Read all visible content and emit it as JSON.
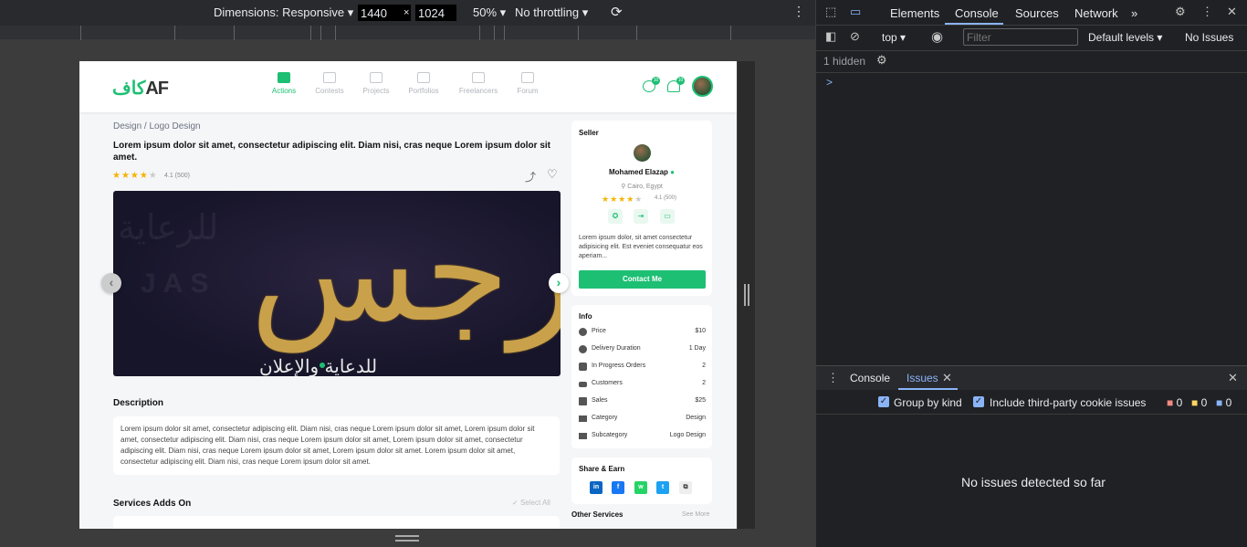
{
  "device_toolbar": {
    "dimensions_label": "Dimensions: Responsive",
    "width": "1440",
    "height": "1024",
    "times": "×",
    "zoom": "50%",
    "throttling": "No throttling"
  },
  "site": {
    "logo_prefix": "كاف",
    "logo_text": "AF",
    "nav": [
      {
        "label": "Actions",
        "active": true
      },
      {
        "label": "Contests"
      },
      {
        "label": "Projects"
      },
      {
        "label": "Portfolios"
      },
      {
        "label": "Freelancers"
      },
      {
        "label": "Forum"
      }
    ],
    "messages_badge": "10",
    "notifications_badge": "10",
    "breadcrumb": "Design / Logo Design",
    "title": "Lorem ipsum dolor sit amet, consectetur adipiscing elit. Diam nisi, cras neque Lorem ipsum dolor sit amet.",
    "rating": "4.1 (500)",
    "hero_text": "البرجس",
    "hero_sub": "للدعاية والإعلان",
    "description_heading": "Description",
    "description": "Lorem ipsum dolor sit amet, consectetur adipiscing elit. Diam nisi, cras neque Lorem ipsum dolor sit amet, Lorem ipsum dolor sit amet, consectetur adipiscing elit. Diam nisi, cras neque Lorem ipsum dolor sit amet, Lorem ipsum dolor sit amet, consectetur adipiscing elit. Diam nisi, cras neque Lorem ipsum dolor sit amet, Lorem ipsum dolor sit amet. Lorem ipsum dolor sit amet, consectetur adipiscing elit. Diam nisi, cras neque Lorem ipsum dolor sit amet.",
    "addons_heading": "Services Adds On",
    "select_all": "Select All",
    "seller": {
      "label": "Seller",
      "name": "Mohamed Elazap",
      "location": "Cairo, Egypt",
      "rating": "4.1 (500)",
      "bio": "Lorem ipsum dolor, sit amet consectetur adipisicing elit. Est eveniet consequatur eos aperiam...",
      "contact_label": "Contact Me"
    },
    "info": {
      "label": "Info",
      "rows": [
        {
          "key": "Price",
          "value": "$10"
        },
        {
          "key": "Delivery Duration",
          "value": "1 Day"
        },
        {
          "key": "In Progress Orders",
          "value": "2"
        },
        {
          "key": "Customers",
          "value": "2"
        },
        {
          "key": "Sales",
          "value": "$25"
        },
        {
          "key": "Category",
          "value": "Design"
        },
        {
          "key": "Subcategory",
          "value": "Logo Design"
        }
      ]
    },
    "share_label": "Share & Earn",
    "share_icons": [
      "in",
      "f",
      "w",
      "t",
      "⧉"
    ],
    "other_services": "Other Services",
    "see_more": "See More",
    "brand_color": "#1dbf73"
  },
  "devtools": {
    "tabs": [
      "Elements",
      "Console",
      "Sources",
      "Network"
    ],
    "active_tab": "Console",
    "context": "top",
    "filter_placeholder": "Filter",
    "levels": "Default levels",
    "issues_status": "No Issues",
    "hidden": "1 hidden",
    "prompt": ">",
    "drawer_tabs": [
      "Console",
      "Issues"
    ],
    "group_by_kind": "Group by kind",
    "third_party": "Include third-party cookie issues",
    "counts": [
      "0",
      "0",
      "0"
    ],
    "no_issues": "No issues detected so far"
  }
}
